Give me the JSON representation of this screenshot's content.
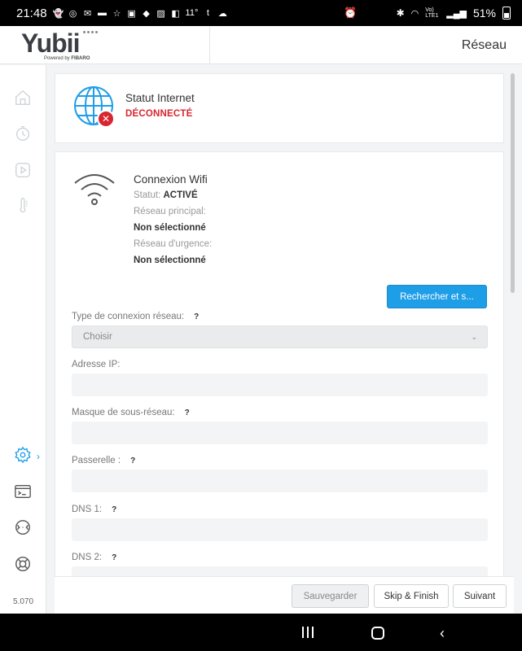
{
  "status_bar": {
    "time": "21:48",
    "notification_icons": [
      "snapchat-icon",
      "chrome-icon",
      "gmail-icon",
      "mail-icon",
      "star-icon",
      "flipboard-icon",
      "linkedin-icon",
      "maps-icon",
      "photos-icon",
      "flipboard-icon",
      "temp-icon",
      "tumblr-icon",
      "cloud-icon"
    ],
    "temperature": "11°",
    "network": "Vo) LTE1",
    "battery": "51%"
  },
  "header": {
    "logo_text": "Yubii",
    "logo_sub_prefix": "Powered by",
    "logo_sub_brand": "FIBARO",
    "page_title": "Réseau"
  },
  "sidebar": {
    "items": [
      {
        "name": "home-icon"
      },
      {
        "name": "clock-icon"
      },
      {
        "name": "play-icon"
      },
      {
        "name": "thermometer-icon"
      },
      {
        "name": "settings-icon",
        "active": true
      },
      {
        "name": "terminal-icon"
      },
      {
        "name": "network-icon"
      },
      {
        "name": "lifebuoy-icon"
      }
    ],
    "active_arrow": "›",
    "version": "5.070"
  },
  "internet_card": {
    "title": "Statut Internet",
    "status": "DÉCONNECTÉ",
    "status_color": "#d82630",
    "badge": "✕"
  },
  "wifi_card": {
    "title": "Connexion Wifi",
    "status_label": "Statut:",
    "status_value": "ACTIVÉ",
    "main_network_label": "Réseau principal:",
    "main_network_value": "Non sélectionné",
    "emergency_network_label": "Réseau d'urgence:",
    "emergency_network_value": "Non sélectionné",
    "search_button": "Rechercher et s..."
  },
  "form": {
    "connection_type_label": "Type de connexion réseau:",
    "connection_type_value": "Choisir",
    "ip_label": "Adresse IP:",
    "mask_label": "Masque de sous-réseau:",
    "gateway_label": "Passerelle :",
    "dns1_label": "DNS 1:",
    "dns2_label": "DNS 2:",
    "help_mark": "?"
  },
  "toolbar": {
    "save": "Sauvegarder",
    "skip": "Skip & Finish",
    "next": "Suivant"
  },
  "colors": {
    "accent": "#1f9ee8",
    "error": "#d82630"
  }
}
